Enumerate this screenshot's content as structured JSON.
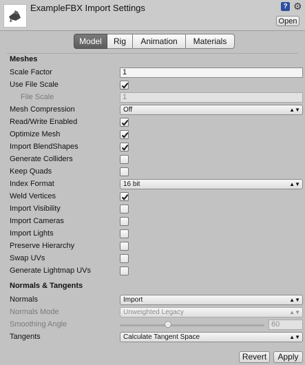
{
  "header": {
    "title": "ExampleFBX Import Settings",
    "open_label": "Open",
    "help_glyph": "?",
    "icons": [
      "fbx-asset-icon",
      "help-icon",
      "gear-icon"
    ]
  },
  "tabs": [
    {
      "label": "Model",
      "active": true
    },
    {
      "label": "Rig",
      "active": false
    },
    {
      "label": "Animation",
      "active": false
    },
    {
      "label": "Materials",
      "active": false
    }
  ],
  "meshes": {
    "heading": "Meshes",
    "scale_factor": {
      "label": "Scale Factor",
      "value": "1"
    },
    "use_file_scale": {
      "label": "Use File Scale",
      "checked": true
    },
    "file_scale": {
      "label": "File Scale",
      "value": "1"
    },
    "mesh_compression": {
      "label": "Mesh Compression",
      "value": "Off"
    },
    "read_write": {
      "label": "Read/Write Enabled",
      "checked": true
    },
    "optimize_mesh": {
      "label": "Optimize Mesh",
      "checked": true
    },
    "import_blendshapes": {
      "label": "Import BlendShapes",
      "checked": true
    },
    "generate_colliders": {
      "label": "Generate Colliders",
      "checked": false
    },
    "keep_quads": {
      "label": "Keep Quads",
      "checked": false
    },
    "index_format": {
      "label": "Index Format",
      "value": "16 bit"
    },
    "weld_vertices": {
      "label": "Weld Vertices",
      "checked": true
    },
    "import_visibility": {
      "label": "Import Visibility",
      "checked": false
    },
    "import_cameras": {
      "label": "Import Cameras",
      "checked": false
    },
    "import_lights": {
      "label": "Import Lights",
      "checked": false
    },
    "preserve_hierarchy": {
      "label": "Preserve Hierarchy",
      "checked": false
    },
    "swap_uvs": {
      "label": "Swap UVs",
      "checked": false
    },
    "generate_lightmap_uvs": {
      "label": "Generate Lightmap UVs",
      "checked": false
    }
  },
  "normals_tangents": {
    "heading": "Normals & Tangents",
    "normals": {
      "label": "Normals",
      "value": "Import"
    },
    "normals_mode": {
      "label": "Normals Mode",
      "value": "Unweighted Legacy"
    },
    "smoothing_angle": {
      "label": "Smoothing Angle",
      "value": "60",
      "max": 180
    },
    "tangents": {
      "label": "Tangents",
      "value": "Calculate Tangent Space"
    }
  },
  "footer": {
    "revert_label": "Revert",
    "apply_label": "Apply"
  },
  "colors": {
    "panel": "#c2c2c2",
    "active_tab": "#6a6a6a",
    "check": "#1a1a1a"
  }
}
